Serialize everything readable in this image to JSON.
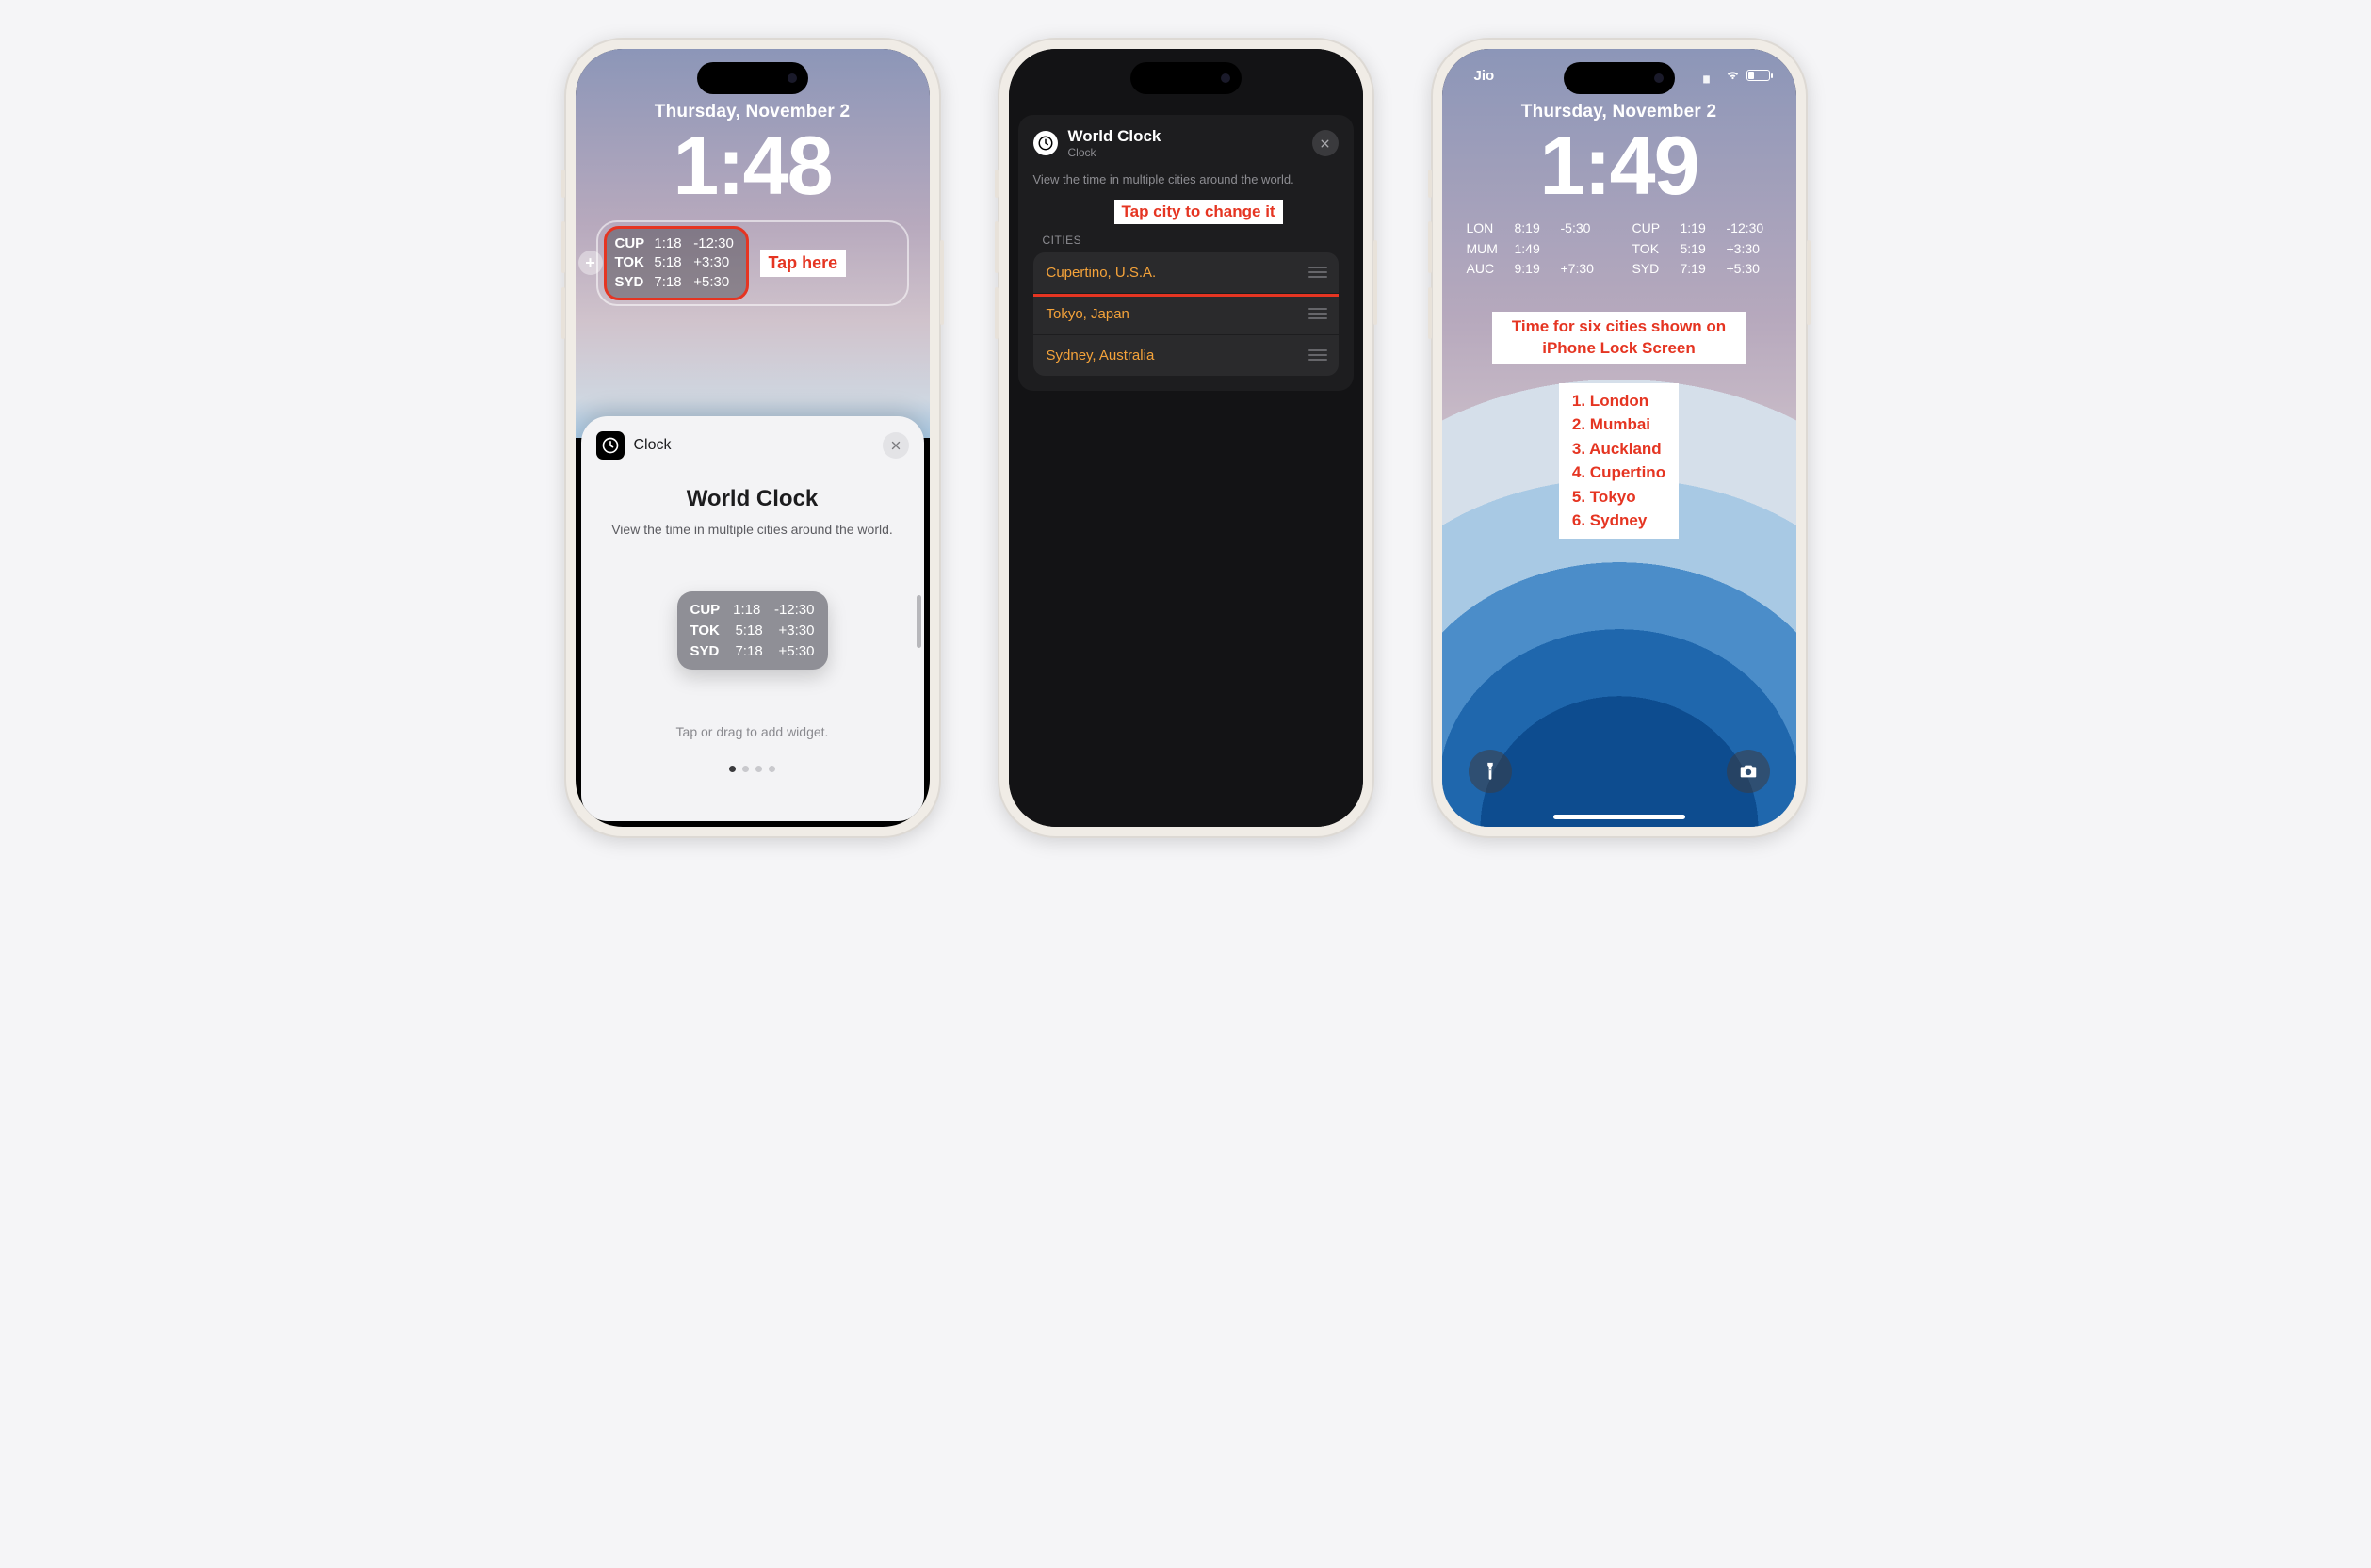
{
  "phone1": {
    "lockscreen": {
      "date": "Thursday, November 2",
      "time": "1:48",
      "widget": {
        "rows": [
          {
            "code": "CUP",
            "time": "1:18",
            "offset": "-12:30"
          },
          {
            "code": "TOK",
            "time": "5:18",
            "offset": "+3:30"
          },
          {
            "code": "SYD",
            "time": "7:18",
            "offset": "+5:30"
          }
        ]
      },
      "annotation": "Tap here"
    },
    "sheet": {
      "app_name": "Clock",
      "title": "World Clock",
      "subtitle": "View the time in multiple cities around the world.",
      "preview_rows": [
        {
          "code": "CUP",
          "time": "1:18",
          "offset": "-12:30"
        },
        {
          "code": "TOK",
          "time": "5:18",
          "offset": "+3:30"
        },
        {
          "code": "SYD",
          "time": "7:18",
          "offset": "+5:30"
        }
      ],
      "hint": "Tap or drag to add widget.",
      "page_index": 0,
      "page_count": 4
    }
  },
  "phone2": {
    "card": {
      "title": "World Clock",
      "subtitle": "Clock",
      "description": "View the time in multiple cities around the world.",
      "annotation": "Tap city to change it",
      "section_label": "CITIES",
      "cities": [
        "Cupertino, U.S.A.",
        "Tokyo, Japan",
        "Sydney, Australia"
      ]
    }
  },
  "phone3": {
    "status": {
      "carrier": "Jio"
    },
    "lockscreen": {
      "date": "Thursday, November 2",
      "time": "1:49",
      "cities_left": [
        {
          "code": "LON",
          "time": "8:19",
          "offset": "-5:30"
        },
        {
          "code": "MUM",
          "time": "1:49",
          "offset": ""
        },
        {
          "code": "AUC",
          "time": "9:19",
          "offset": "+7:30"
        }
      ],
      "cities_right": [
        {
          "code": "CUP",
          "time": "1:19",
          "offset": "-12:30"
        },
        {
          "code": "TOK",
          "time": "5:19",
          "offset": "+3:30"
        },
        {
          "code": "SYD",
          "time": "7:19",
          "offset": "+5:30"
        }
      ]
    },
    "annotation": {
      "headline": "Time for six cities shown on iPhone Lock Screen",
      "list": [
        "1. London",
        "2. Mumbai",
        "3. Auckland",
        "4. Cupertino",
        "5. Tokyo",
        "6. Sydney"
      ]
    }
  }
}
